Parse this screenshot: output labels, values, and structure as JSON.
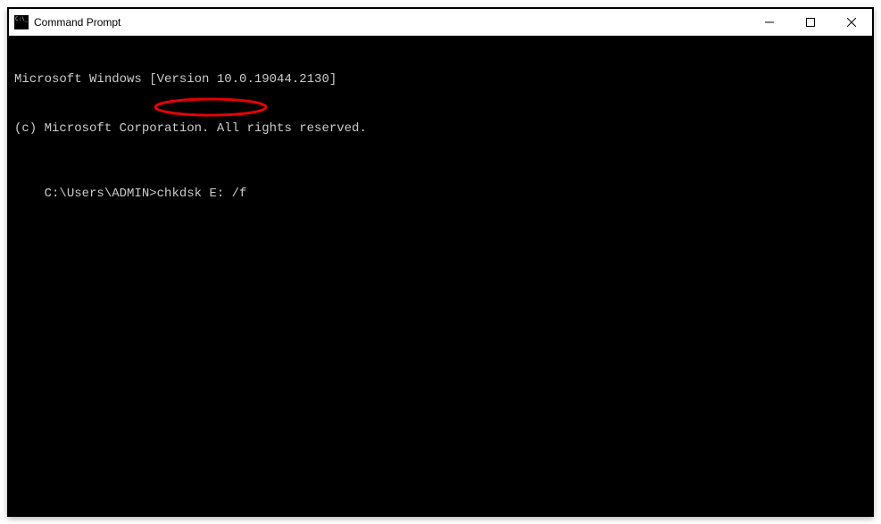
{
  "window": {
    "title": "Command Prompt"
  },
  "terminal": {
    "line1": "Microsoft Windows [Version 10.0.19044.2130]",
    "line2": "(c) Microsoft Corporation. All rights reserved.",
    "blank": "",
    "prompt": "C:\\Users\\ADMIN>",
    "command": "chkdsk E: /f"
  },
  "annotation": {
    "color": "#E60000"
  }
}
